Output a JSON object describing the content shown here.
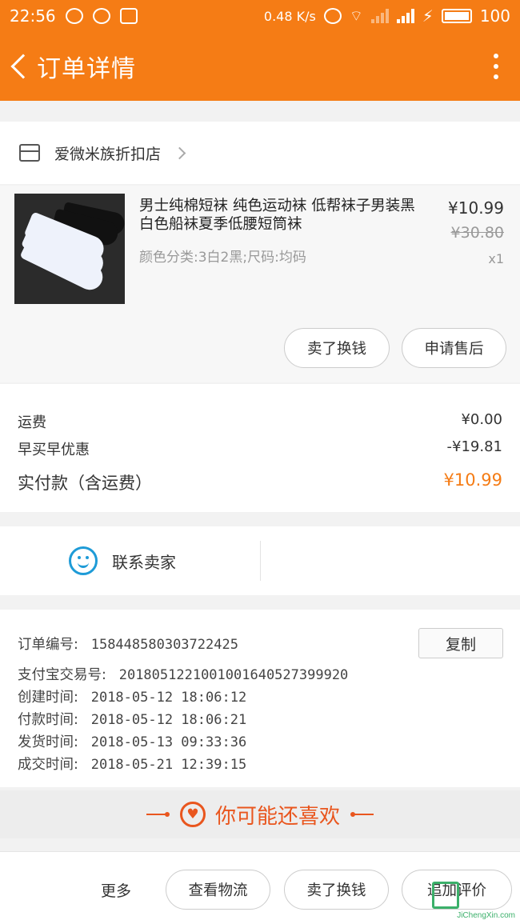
{
  "status_bar": {
    "time": "22:56",
    "network_speed": "0.48 K/s",
    "battery": "100"
  },
  "header": {
    "title": "订单详情",
    "back_icon": "chevron-left-icon",
    "menu_icon": "more-vertical-icon"
  },
  "shop": {
    "name": "爱微米族折扣店"
  },
  "product": {
    "name": "男士纯棉短袜 纯色运动袜 低帮袜子男装黑白色船袜夏季低腰短筒袜",
    "sku": "颜色分类:3白2黑;尺码:均码",
    "price": "¥10.99",
    "original_price": "¥30.80",
    "quantity": "x1",
    "actions": {
      "sell": "卖了换钱",
      "after_sale": "申请售后"
    }
  },
  "fees": {
    "shipping_label": "运费",
    "shipping_value": "¥0.00",
    "discount_label": "早买早优惠",
    "discount_value": "-¥19.81",
    "total_label": "实付款（含运费）",
    "total_value": "¥10.99"
  },
  "contact": {
    "label": "联系卖家"
  },
  "order_info": {
    "order_no_label": "订单编号:",
    "order_no": "1584485803037224 25",
    "copy_label": "复制",
    "alipay_label": "支付宝交易号:",
    "alipay_no": "2018051221001001640527399920",
    "created_label": "创建时间:",
    "created": "2018-05-12 18:06:12",
    "paid_label": "付款时间:",
    "paid": "2018-05-12 18:06:21",
    "shipped_label": "发货时间:",
    "shipped": "2018-05-13 09:33:36",
    "completed_label": "成交时间:",
    "completed": "2018-05-21 12:39:15"
  },
  "recommend": {
    "title": "你可能还喜欢"
  },
  "bottom_bar": {
    "more": "更多",
    "logistics": "查看物流",
    "sell": "卖了换钱",
    "review": "追加评价"
  },
  "watermark": {
    "url": "JiChengXin.com"
  },
  "colors": {
    "accent": "#f57c15",
    "price_highlight": "#f57c15",
    "recommend": "#e9561e",
    "contact_icon": "#1e9bd7"
  }
}
